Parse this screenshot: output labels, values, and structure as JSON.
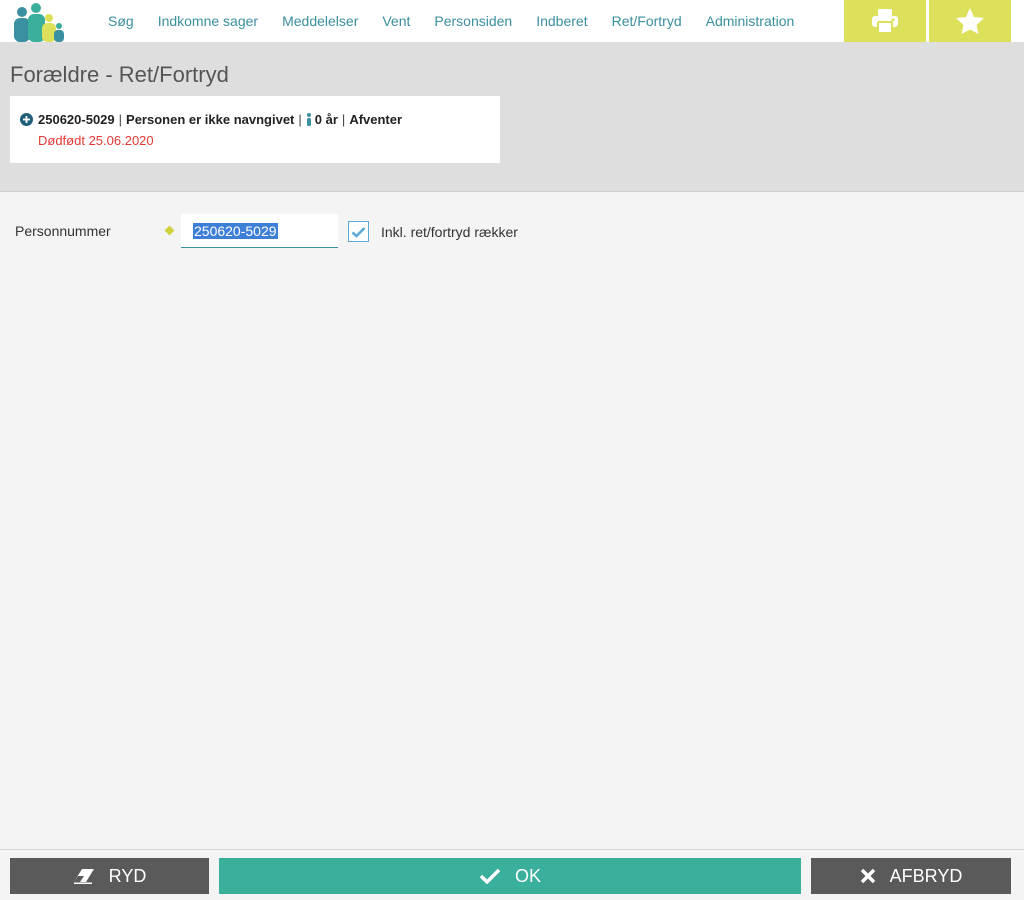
{
  "nav": {
    "items": [
      {
        "label": "Søg"
      },
      {
        "label": "Indkomne sager"
      },
      {
        "label": "Meddelelser"
      },
      {
        "label": "Vent"
      },
      {
        "label": "Personsiden"
      },
      {
        "label": "Indberet"
      },
      {
        "label": "Ret/Fortryd"
      },
      {
        "label": "Administration"
      }
    ],
    "print_icon": "printer-icon",
    "favorite_icon": "star-icon"
  },
  "page": {
    "title": "Forældre - Ret/Fortryd"
  },
  "person": {
    "cpr": "250620-5029",
    "name": "Personen er ikke navngivet",
    "age": "0 år",
    "status": "Afventer",
    "note": "Dødfødt 25.06.2020",
    "sep": "|"
  },
  "form": {
    "personnummer_label": "Personnummer",
    "personnummer_value": "250620-5029",
    "checkbox_label": "Inkl. ret/fortryd rækker",
    "checkbox_checked": true
  },
  "footer": {
    "clear_label": "RYD",
    "ok_label": "OK",
    "cancel_label": "AFBRYD"
  },
  "colors": {
    "accent": "#3a8fa0",
    "ok": "#3aaf9b",
    "toolbar_button": "#dde05a",
    "error": "#e53935"
  }
}
